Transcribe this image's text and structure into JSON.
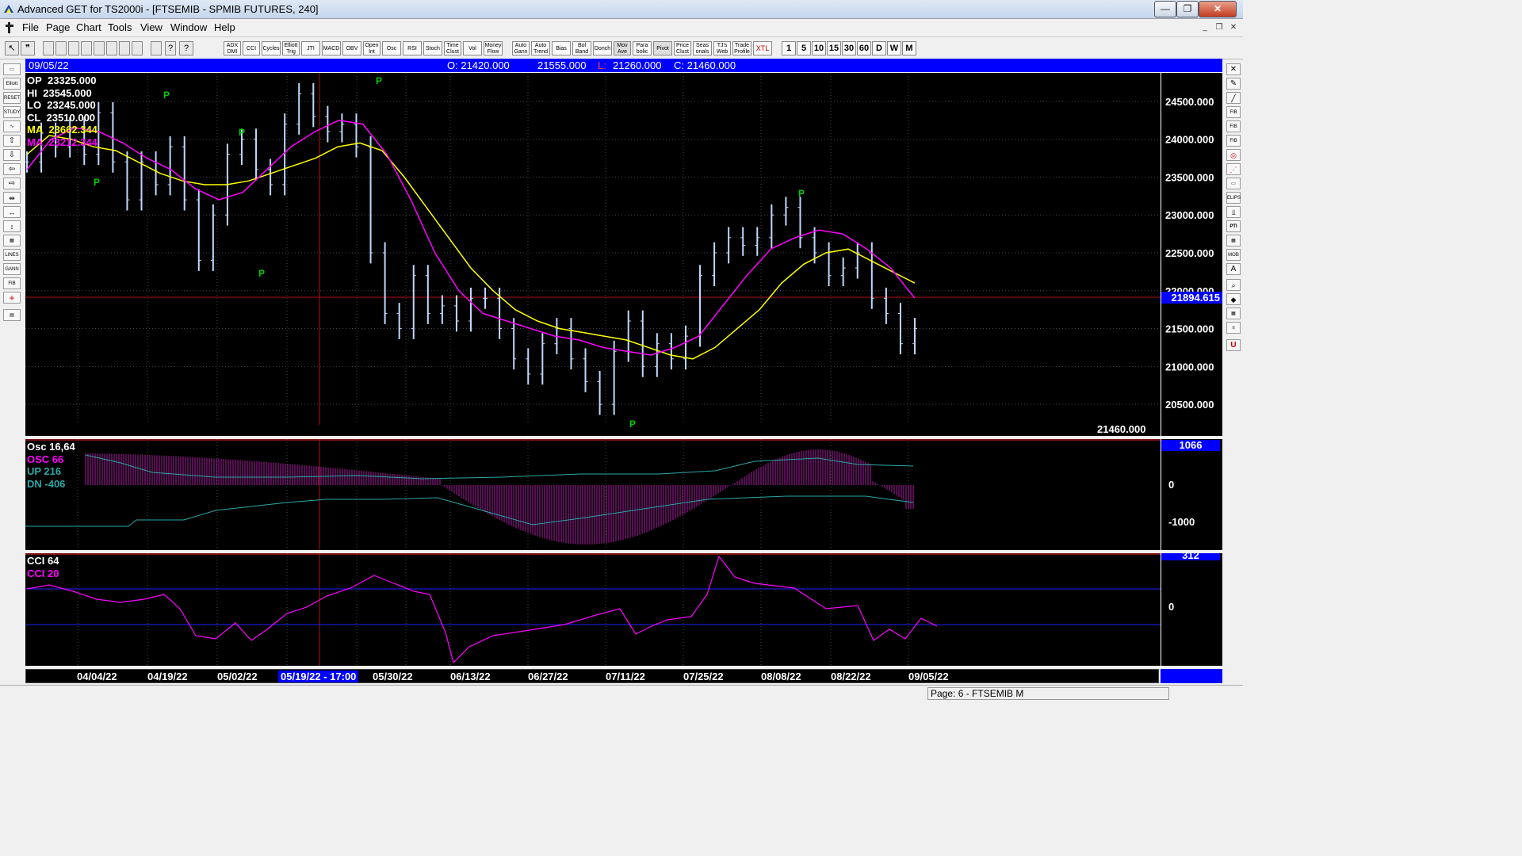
{
  "window": {
    "title": "Advanced GET for TS2000i - [FTSEMIB - SPMIB FUTURES, 240]",
    "min_label": "—",
    "max_label": "❐",
    "close_label": "✕"
  },
  "menu": [
    "File",
    "Page",
    "Chart",
    "Tools",
    "View",
    "Window",
    "Help"
  ],
  "toolbar": {
    "studies": [
      "ADX DMI",
      "CCI",
      "Cycles",
      "Elliott Trig",
      "JTI",
      "MACD",
      "OBV",
      "Open Int",
      "Osc",
      "RSI",
      "Stoch",
      "Time Clust",
      "Vol",
      "Money Flow",
      "Auto Gann",
      "Auto Trend",
      "Bias",
      "Bol Band",
      "Donch",
      "Mov Ave",
      "Para bolic",
      "Pivot",
      "Price Clust",
      "Seas onals",
      "TJ's Web",
      "Trade Profile",
      "XTL"
    ],
    "timeframes": [
      "1",
      "5",
      "10",
      "15",
      "30",
      "60",
      "D",
      "W",
      "M"
    ]
  },
  "left_tools": [
    "Elliott",
    "STUDY",
    "RESET",
    "LINES",
    "GANN",
    "FIB"
  ],
  "right_tools": [
    "FIB RET",
    "FIB EXT",
    "FIB TIME",
    "ELIPS",
    "PTI",
    "MOB"
  ],
  "infobar": {
    "date": "09/05/22",
    "open": "O: 21420.000",
    "high": "21555.000",
    "low_label": "L:",
    "low": "21260.000",
    "close": "C: 21460.000"
  },
  "price_panel": {
    "readout": [
      {
        "label": "OP",
        "value": "23325.000",
        "color": "#ffffff"
      },
      {
        "label": "HI",
        "value": "23545.000",
        "color": "#ffffff"
      },
      {
        "label": "LO",
        "value": "23245.000",
        "color": "#ffffff"
      },
      {
        "label": "CL",
        "value": "23510.000",
        "color": "#ffffff"
      },
      {
        "label": "MA",
        "value": "23662.344",
        "color": "#ffff00"
      },
      {
        "label": "MA",
        "value": "23212.344",
        "color": "#ff00ff"
      }
    ],
    "cursor_price": "21894.615",
    "last_price": "21460.000",
    "pivot_label": "P"
  },
  "osc_panel": {
    "readout": [
      {
        "text": "Osc 16,64",
        "color": "#ffffff"
      },
      {
        "text": "OSC 66",
        "color": "#ff00ff"
      },
      {
        "text": "UP   216",
        "color": "#2aa8a8"
      },
      {
        "text": "DN   -406",
        "color": "#2aa8a8"
      }
    ],
    "top_value": "1066",
    "zero": "0",
    "minus": "-1000"
  },
  "cci_panel": {
    "readout": [
      {
        "text": "CCI 64",
        "color": "#ffffff"
      },
      {
        "text": "CCI  20",
        "color": "#ff00ff"
      }
    ],
    "top_value": "312",
    "zero": "0"
  },
  "dates": [
    "04/04/22",
    "04/19/22",
    "05/02/22",
    "05/19/22 - 17:00",
    "05/30/22",
    "06/13/22",
    "06/27/22",
    "07/11/22",
    "07/25/22",
    "08/08/22",
    "08/22/22",
    "09/05/22"
  ],
  "status": {
    "page": "Page: 6 - FTSEMIB M"
  },
  "chart_data": {
    "type": "line",
    "title": "",
    "y_ticks": [
      20500,
      21000,
      21500,
      22000,
      22500,
      23000,
      23500,
      24000,
      24500
    ],
    "ylim": [
      20250,
      24750
    ],
    "x_labels": [
      "04/04/22",
      "04/19/22",
      "05/02/22",
      "05/19/22",
      "05/30/22",
      "06/13/22",
      "06/27/22",
      "07/11/22",
      "07/25/22",
      "08/08/22",
      "08/22/22",
      "09/05/22"
    ],
    "series": [
      {
        "values": [
          23700,
          24080,
          23900,
          24150,
          23800,
          24350,
          23700,
          23200,
          23700,
          23400,
          23900,
          23200,
          22400,
          23000,
          23800,
          24000,
          23600,
          23400,
          24200,
          24600,
          24300,
          24100,
          24200,
          23900,
          22500,
          21700,
          21500,
          22200,
          21700,
          21800,
          21600,
          21900,
          21900,
          21500,
          21100,
          20900,
          21300,
          21500,
          21100,
          20800,
          20500,
          21200,
          21600,
          21000,
          21300,
          21100,
          21400,
          22200,
          22500,
          22700,
          22600,
          22700,
          23000,
          23100,
          22700,
          22500,
          22200,
          22300,
          22500,
          21900,
          21700,
          21300,
          21500
        ],
        "color": "#c0d8ff"
      },
      {
        "values": [
          23800,
          24050,
          24000,
          23900,
          23850,
          23700,
          23550,
          23450,
          23400,
          23400,
          23450,
          23550,
          23650,
          23750,
          23900,
          23950,
          23850,
          23500,
          23100,
          22700,
          22300,
          22000,
          21750,
          21600,
          21500,
          21450,
          21400,
          21350,
          21250,
          21150,
          21100,
          21250,
          21500,
          21750,
          22100,
          22350,
          22500,
          22550,
          22400,
          22250,
          22100
        ],
        "color": "#ffff00"
      },
      {
        "values": [
          23600,
          24000,
          24150,
          24100,
          23950,
          23750,
          23600,
          23350,
          23200,
          23300,
          23600,
          23900,
          24100,
          24250,
          24200,
          23800,
          23200,
          22500,
          22000,
          21700,
          21600,
          21500,
          21400,
          21350,
          21250,
          21200,
          21150,
          21250,
          21400,
          21800,
          22200,
          22550,
          22700,
          22800,
          22750,
          22550,
          22300,
          21900
        ],
        "color": "#ff00ff"
      }
    ]
  }
}
